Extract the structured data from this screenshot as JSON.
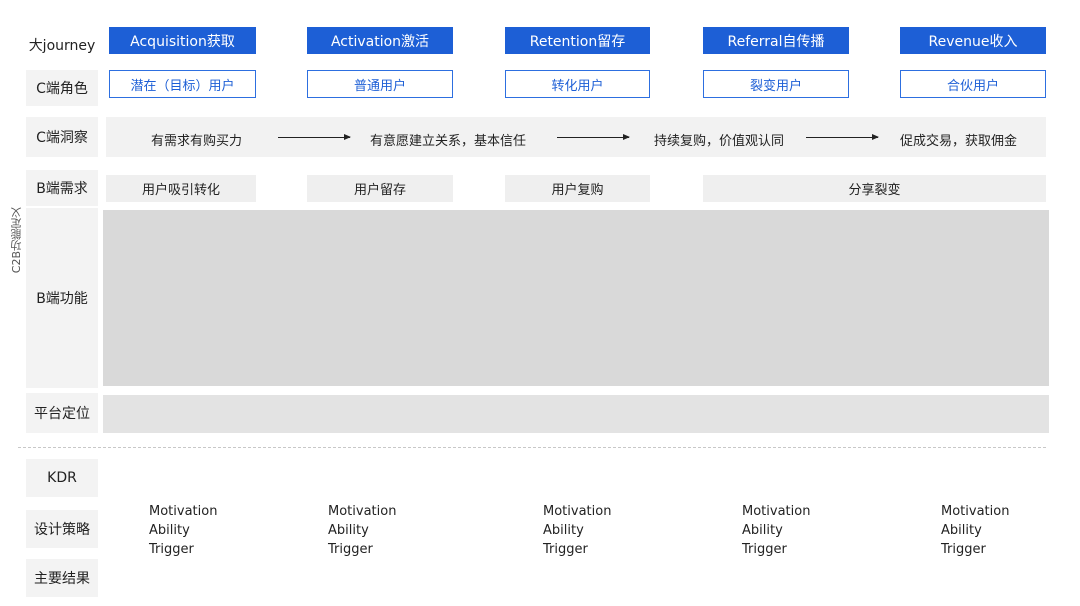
{
  "side_label": "C2B功能定义",
  "row_labels": {
    "journey": "大journey",
    "c_role": "C端角色",
    "c_insight": "C端洞察",
    "b_need": "B端需求",
    "b_function": "B端功能",
    "platform": "平台定位",
    "kdr": "KDR",
    "design": "设计策略",
    "result": "主要结果"
  },
  "stages": [
    "Acquisition获取",
    "Activation激活",
    "Retention留存",
    "Referral自传播",
    "Revenue收入"
  ],
  "roles": [
    "潜在（目标）用户",
    "普通用户",
    "转化用户",
    "裂变用户",
    "合伙用户"
  ],
  "insights": [
    "有需求有购买力",
    "有意愿建立关系，基本信任",
    "持续复购，价值观认同",
    "促成交易，获取佣金"
  ],
  "b_needs": [
    "用户吸引转化",
    "用户留存",
    "用户复购",
    "分享裂变"
  ],
  "mat": [
    {
      "m": "Motivation",
      "a": "Ability",
      "t": "Trigger"
    },
    {
      "m": "Motivation",
      "a": "Ability",
      "t": "Trigger"
    },
    {
      "m": "Motivation",
      "a": "Ability",
      "t": "Trigger"
    },
    {
      "m": "Motivation",
      "a": "Ability",
      "t": "Trigger"
    },
    {
      "m": "Motivation",
      "a": "Ability",
      "t": "Trigger"
    }
  ],
  "colors": {
    "stage_bg": "#1d5fd6",
    "role_border": "#2d6fe0",
    "label_bg": "#f3f3f3",
    "function_area": "#d9d9d9",
    "platform_area": "#e3e3e3"
  }
}
